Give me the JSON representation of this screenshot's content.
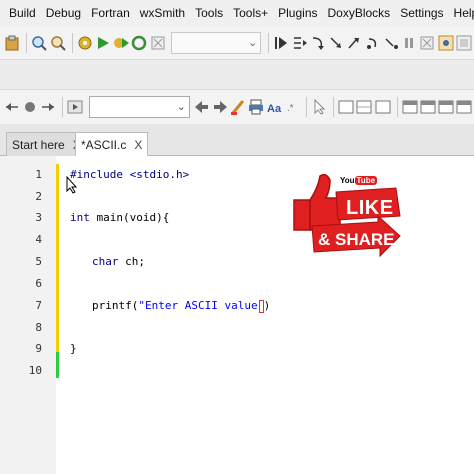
{
  "menu": [
    "Build",
    "Debug",
    "Fortran",
    "wxSmith",
    "Tools",
    "Tools+",
    "Plugins",
    "DoxyBlocks",
    "Settings",
    "Help"
  ],
  "tabs": [
    {
      "label": "Start here",
      "close": "X"
    },
    {
      "label": "*ASCII.c",
      "close": "X"
    }
  ],
  "editor": {
    "line_numbers": [
      "1",
      "2",
      "3",
      "4",
      "5",
      "6",
      "7",
      "8",
      "9",
      "10"
    ],
    "lines": {
      "l1": "#include <stdio.h>",
      "l3_kw": "int",
      "l3_rest": " main(void){",
      "l5_kw": "char",
      "l5_rest": " ch;",
      "l7_fn": "printf(",
      "l7_str": "\"Enter ASCII value",
      "l7_close": ")",
      "l9": "}"
    }
  },
  "badge": {
    "youtube_you": "You",
    "youtube_tube": "Tube",
    "like": "LIKE",
    "share": "& SHARE"
  },
  "colors": {
    "badge_red": "#e02020",
    "badge_dark_red": "#b81414",
    "keyword": "#00008b",
    "string": "#0000ff",
    "change_yellow": "#f0d000",
    "change_green": "#2ecc40"
  }
}
